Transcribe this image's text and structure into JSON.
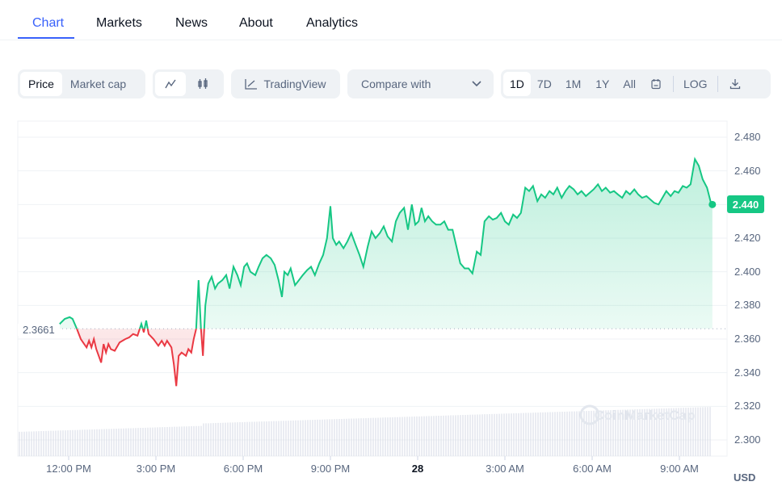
{
  "tabs": [
    {
      "label": "Chart",
      "active": true
    },
    {
      "label": "Markets"
    },
    {
      "label": "News"
    },
    {
      "label": "About"
    },
    {
      "label": "Analytics"
    }
  ],
  "toolbar": {
    "price_label": "Price",
    "market_cap_label": "Market cap",
    "line_icon": "line-chart-icon",
    "candle_icon": "candlestick-icon",
    "tradingview_label": "TradingView",
    "compare_label": "Compare with",
    "ranges": [
      "1D",
      "7D",
      "1M",
      "1Y",
      "All"
    ],
    "active_range": "1D",
    "log_label": "LOG"
  },
  "colors": {
    "up": "#16c784",
    "down": "#ea3943",
    "accent": "#3861fb"
  },
  "watermark": "CoinMarketCap",
  "currency": "USD",
  "chart_data": {
    "type": "line",
    "reference_price": "2.3661",
    "last_price": "2.440",
    "ylim": [
      2.29,
      2.485
    ],
    "y_ticks": [
      "2.480",
      "2.460",
      "2.440",
      "2.420",
      "2.400",
      "2.380",
      "2.360",
      "2.340",
      "2.320",
      "2.300"
    ],
    "x_ticks": [
      "12:00 PM",
      "3:00 PM",
      "6:00 PM",
      "9:00 PM",
      "28",
      "3:00 AM",
      "6:00 AM",
      "9:00 AM"
    ],
    "grid": "horizontal",
    "points": [
      [
        "11:38",
        2.368
      ],
      [
        "11:52",
        2.372
      ],
      [
        "12:02",
        2.373
      ],
      [
        "12:08",
        2.372
      ],
      [
        "12:17",
        2.366
      ],
      [
        "12:25",
        2.36
      ],
      [
        "12:32",
        2.357
      ],
      [
        "12:37",
        2.355
      ],
      [
        "12:42",
        2.359
      ],
      [
        "12:47",
        2.355
      ],
      [
        "12:52",
        2.36
      ],
      [
        "12:57",
        2.354
      ],
      [
        "13:02",
        2.35
      ],
      [
        "13:07",
        2.346
      ],
      [
        "13:12",
        2.357
      ],
      [
        "13:17",
        2.352
      ],
      [
        "13:22",
        2.357
      ],
      [
        "13:27",
        2.354
      ],
      [
        "13:35",
        2.353
      ],
      [
        "13:45",
        2.358
      ],
      [
        "13:57",
        2.36
      ],
      [
        "14:05",
        2.361
      ],
      [
        "14:13",
        2.363
      ],
      [
        "14:22",
        2.362
      ],
      [
        "14:30",
        2.369
      ],
      [
        "14:35",
        2.364
      ],
      [
        "14:40",
        2.371
      ],
      [
        "14:45",
        2.363
      ],
      [
        "14:55",
        2.36
      ],
      [
        "15:05",
        2.356
      ],
      [
        "15:12",
        2.359
      ],
      [
        "15:18",
        2.356
      ],
      [
        "15:23",
        2.359
      ],
      [
        "15:32",
        2.355
      ],
      [
        "15:37",
        2.345
      ],
      [
        "15:42",
        2.332
      ],
      [
        "15:47",
        2.35
      ],
      [
        "15:53",
        2.352
      ],
      [
        "16:02",
        2.35
      ],
      [
        "16:07",
        2.354
      ],
      [
        "16:13",
        2.352
      ],
      [
        "16:18",
        2.36
      ],
      [
        "16:23",
        2.366
      ],
      [
        "16:28",
        2.395
      ],
      [
        "16:33",
        2.366
      ],
      [
        "16:37",
        2.35
      ],
      [
        "16:42",
        2.38
      ],
      [
        "16:48",
        2.393
      ],
      [
        "16:55",
        2.397
      ],
      [
        "17:02",
        2.39
      ],
      [
        "17:08",
        2.393
      ],
      [
        "17:17",
        2.395
      ],
      [
        "17:25",
        2.398
      ],
      [
        "17:32",
        2.39
      ],
      [
        "17:40",
        2.403
      ],
      [
        "17:48",
        2.398
      ],
      [
        "17:55",
        2.392
      ],
      [
        "18:02",
        2.403
      ],
      [
        "18:08",
        2.405
      ],
      [
        "18:15",
        2.4
      ],
      [
        "18:25",
        2.398
      ],
      [
        "18:32",
        2.403
      ],
      [
        "18:40",
        2.408
      ],
      [
        "18:48",
        2.41
      ],
      [
        "18:57",
        2.408
      ],
      [
        "19:05",
        2.404
      ],
      [
        "19:13",
        2.395
      ],
      [
        "19:20",
        2.385
      ],
      [
        "19:25",
        2.4
      ],
      [
        "19:32",
        2.398
      ],
      [
        "19:38",
        2.402
      ],
      [
        "19:47",
        2.392
      ],
      [
        "19:55",
        2.395
      ],
      [
        "20:03",
        2.398
      ],
      [
        "20:12",
        2.401
      ],
      [
        "20:20",
        2.403
      ],
      [
        "20:28",
        2.398
      ],
      [
        "20:37",
        2.405
      ],
      [
        "20:45",
        2.41
      ],
      [
        "20:53",
        2.42
      ],
      [
        "21:00",
        2.439
      ],
      [
        "21:05",
        2.42
      ],
      [
        "21:12",
        2.416
      ],
      [
        "21:18",
        2.418
      ],
      [
        "21:27",
        2.414
      ],
      [
        "21:35",
        2.418
      ],
      [
        "21:43",
        2.423
      ],
      [
        "21:52",
        2.416
      ],
      [
        "22:00",
        2.41
      ],
      [
        "22:08",
        2.403
      ],
      [
        "22:17",
        2.415
      ],
      [
        "22:25",
        2.424
      ],
      [
        "22:33",
        2.42
      ],
      [
        "22:42",
        2.423
      ],
      [
        "22:50",
        2.427
      ],
      [
        "22:58",
        2.421
      ],
      [
        "23:07",
        2.418
      ],
      [
        "23:15",
        2.43
      ],
      [
        "23:23",
        2.435
      ],
      [
        "23:32",
        2.438
      ],
      [
        "23:40",
        2.425
      ],
      [
        "23:48",
        2.44
      ],
      [
        "23:55",
        2.428
      ],
      [
        "00:02",
        2.43
      ],
      [
        "00:08",
        2.438
      ],
      [
        "00:15",
        2.43
      ],
      [
        "00:22",
        2.433
      ],
      [
        "00:30",
        2.43
      ],
      [
        "00:38",
        2.428
      ],
      [
        "00:47",
        2.428
      ],
      [
        "00:55",
        2.43
      ],
      [
        "01:03",
        2.425
      ],
      [
        "01:12",
        2.425
      ],
      [
        "01:20",
        2.415
      ],
      [
        "01:28",
        2.405
      ],
      [
        "01:37",
        2.402
      ],
      [
        "01:45",
        2.402
      ],
      [
        "01:53",
        2.399
      ],
      [
        "02:02",
        2.412
      ],
      [
        "02:10",
        2.41
      ],
      [
        "02:18",
        2.43
      ],
      [
        "02:27",
        2.433
      ],
      [
        "02:35",
        2.431
      ],
      [
        "02:43",
        2.432
      ],
      [
        "02:52",
        2.435
      ],
      [
        "03:00",
        2.43
      ],
      [
        "03:08",
        2.428
      ],
      [
        "03:17",
        2.434
      ],
      [
        "03:25",
        2.432
      ],
      [
        "03:33",
        2.435
      ],
      [
        "03:42",
        2.45
      ],
      [
        "03:50",
        2.448
      ],
      [
        "03:58",
        2.451
      ],
      [
        "04:07",
        2.442
      ],
      [
        "04:15",
        2.446
      ],
      [
        "04:23",
        2.444
      ],
      [
        "04:32",
        2.448
      ],
      [
        "04:40",
        2.446
      ],
      [
        "04:48",
        2.45
      ],
      [
        "04:57",
        2.444
      ],
      [
        "05:05",
        2.448
      ],
      [
        "05:13",
        2.451
      ],
      [
        "05:22",
        2.449
      ],
      [
        "05:30",
        2.446
      ],
      [
        "05:38",
        2.448
      ],
      [
        "05:47",
        2.445
      ],
      [
        "05:55",
        2.447
      ],
      [
        "06:03",
        2.449
      ],
      [
        "06:12",
        2.452
      ],
      [
        "06:20",
        2.448
      ],
      [
        "06:28",
        2.45
      ],
      [
        "06:37",
        2.447
      ],
      [
        "06:45",
        2.448
      ],
      [
        "06:53",
        2.446
      ],
      [
        "07:02",
        2.444
      ],
      [
        "07:10",
        2.448
      ],
      [
        "07:18",
        2.446
      ],
      [
        "07:27",
        2.449
      ],
      [
        "07:35",
        2.446
      ],
      [
        "07:43",
        2.444
      ],
      [
        "07:52",
        2.445
      ],
      [
        "08:00",
        2.443
      ],
      [
        "08:08",
        2.441
      ],
      [
        "08:17",
        2.44
      ],
      [
        "08:25",
        2.444
      ],
      [
        "08:33",
        2.448
      ],
      [
        "08:42",
        2.445
      ],
      [
        "08:50",
        2.448
      ],
      [
        "08:58",
        2.447
      ],
      [
        "09:07",
        2.451
      ],
      [
        "09:15",
        2.45
      ],
      [
        "09:23",
        2.452
      ],
      [
        "09:32",
        2.467
      ],
      [
        "09:40",
        2.463
      ],
      [
        "09:48",
        2.455
      ],
      [
        "09:57",
        2.45
      ],
      [
        "10:05",
        2.441
      ],
      [
        "10:08",
        2.44
      ]
    ]
  }
}
